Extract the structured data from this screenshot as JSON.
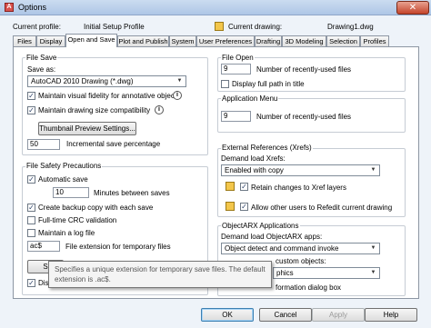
{
  "window": {
    "title": "Options",
    "close_glyph": "✕",
    "app_icon_glyph": "A"
  },
  "profile": {
    "current_profile_label": "Current profile:",
    "current_profile_value": "Initial Setup Profile",
    "current_drawing_label": "Current drawing:",
    "current_drawing_value": "Drawing1.dwg"
  },
  "tabs": [
    "Files",
    "Display",
    "Open and Save",
    "Plot and Publish",
    "System",
    "User Preferences",
    "Drafting",
    "3D Modeling",
    "Selection",
    "Profiles"
  ],
  "active_tab": "Open and Save",
  "file_save": {
    "title": "File Save",
    "save_as_label": "Save as:",
    "save_as_value": "AutoCAD 2010 Drawing (*.dwg)",
    "maintain_fidelity": {
      "label": "Maintain visual fidelity for annotative objects",
      "checked": true
    },
    "maintain_size": {
      "label": "Maintain drawing size compatibility",
      "checked": true
    },
    "thumbnail_button": "Thumbnail Preview Settings...",
    "incremental_value": "50",
    "incremental_label": "Incremental save percentage"
  },
  "file_safety": {
    "title": "File Safety Precautions",
    "automatic_save": {
      "label": "Automatic save",
      "checked": true
    },
    "minutes_value": "10",
    "minutes_label": "Minutes between saves",
    "backup_copy": {
      "label": "Create backup copy with each save",
      "checked": true
    },
    "full_crc": {
      "label": "Full-time CRC validation",
      "checked": false
    },
    "maintain_log": {
      "label": "Maintain a log file",
      "checked": false
    },
    "ext_value": "ac$",
    "ext_label": "File extension for temporary files",
    "security_button_partial": "S",
    "display_partial": "Disp"
  },
  "file_open": {
    "title": "File Open",
    "recent_value": "9",
    "recent_label": "Number of recently-used files",
    "full_path": {
      "label": "Display full path in title",
      "checked": false
    }
  },
  "app_menu": {
    "title": "Application Menu",
    "recent_value": "9",
    "recent_label": "Number of recently-used files"
  },
  "xrefs": {
    "title": "External References (Xrefs)",
    "demand_load_label": "Demand load Xrefs:",
    "demand_load_value": "Enabled with copy",
    "retain_changes": {
      "label": "Retain changes to Xref layers",
      "checked": true
    },
    "allow_others": {
      "label": "Allow other users to Refedit current drawing",
      "checked": true
    }
  },
  "objectarx": {
    "title": "ObjectARX Applications",
    "demand_load_label": "Demand load ObjectARX apps:",
    "demand_load_value": "Object detect and command invoke",
    "custom_objects_partial": "custom objects:",
    "custom_select_partial": "phics",
    "info_dialog_partial": "formation dialog box"
  },
  "tooltip": {
    "line1": "Specifies a unique extension for temporary save files. The default",
    "line2": "extension is .ac$."
  },
  "buttons": {
    "ok": "OK",
    "cancel": "Cancel",
    "apply": "Apply",
    "help": "Help"
  }
}
